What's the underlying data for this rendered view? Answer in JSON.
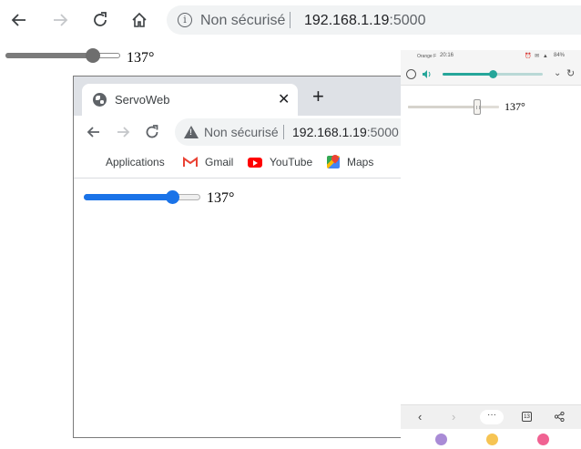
{
  "browser": {
    "security_label": "Non sécurisé",
    "url_host": "192.168.1.19",
    "url_port": ":5000"
  },
  "page": {
    "angle_value": 137,
    "angle_label": "137°"
  },
  "chrome_window": {
    "tab_title": "ServoWeb",
    "security_label": "Non sécurisé",
    "url_host": "192.168.1.19",
    "url_port": ":5000",
    "bookmarks": [
      {
        "label": "Applications",
        "icon": "apps-grid-icon"
      },
      {
        "label": "Gmail",
        "icon": "gmail-icon"
      },
      {
        "label": "YouTube",
        "icon": "youtube-icon"
      },
      {
        "label": "Maps",
        "icon": "maps-icon"
      }
    ],
    "angle_label": "137°"
  },
  "phone": {
    "carrier": "Orange F",
    "time": "20:16",
    "battery": "84%",
    "volume_level": 0.5,
    "angle_label": "137°",
    "tab_count": "13"
  },
  "slider_range": [
    0,
    180
  ],
  "colors": {
    "chrome_accent": "#1a73e8",
    "phone_accent": "#26a69a",
    "youtube_red": "#ff0000"
  }
}
